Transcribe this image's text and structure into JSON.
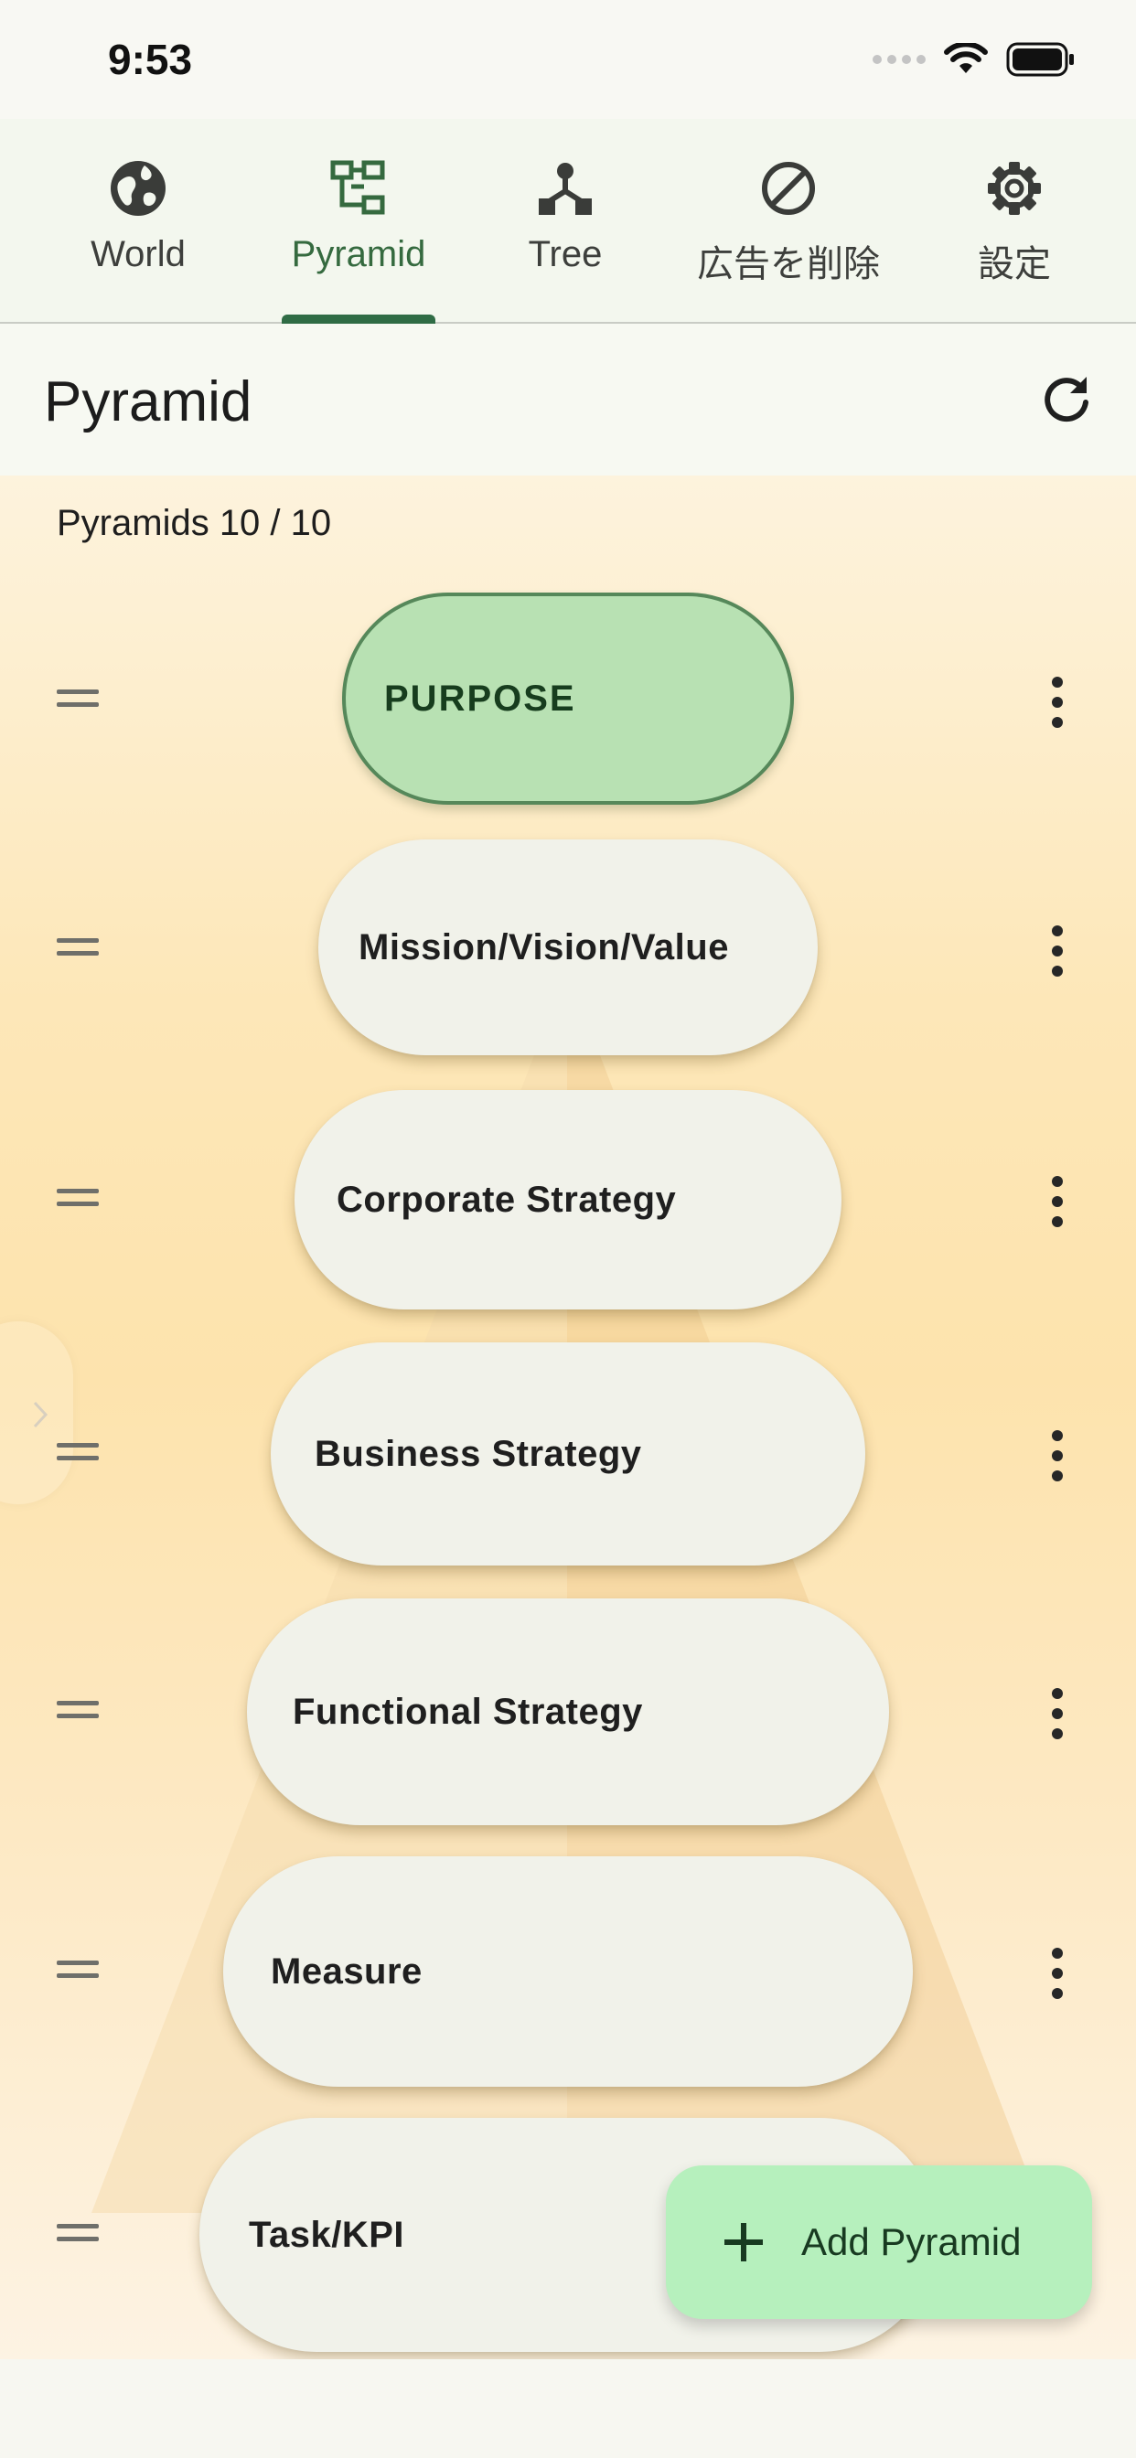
{
  "status_bar": {
    "time": "9:53"
  },
  "tabs": [
    {
      "label": "World",
      "icon": "globe-icon",
      "active": false
    },
    {
      "label": "Pyramid",
      "icon": "pyramid-blocks-icon",
      "active": true
    },
    {
      "label": "Tree",
      "icon": "tree-nodes-icon",
      "active": false
    },
    {
      "label": "広告を削除",
      "icon": "prohibited-icon",
      "active": false
    },
    {
      "label": "設定",
      "icon": "gear-icon",
      "active": false
    }
  ],
  "app_bar": {
    "title": "Pyramid",
    "refresh_icon": "refresh-icon"
  },
  "counter": "Pyramids 10 / 10",
  "levels": [
    {
      "label": "PURPOSE",
      "selected": true
    },
    {
      "label": "Mission/Vision/Value"
    },
    {
      "label": "Corporate Strategy"
    },
    {
      "label": "Business Strategy"
    },
    {
      "label": "Functional Strategy"
    },
    {
      "label": "Measure"
    },
    {
      "label": "Task/KPI"
    }
  ],
  "fab": {
    "label": "Add Pyramid",
    "icon": "plus-icon"
  },
  "colors": {
    "accent": "#356a3f",
    "purpose_fill": "#b8e1b3",
    "purpose_border": "#56885a",
    "fab_fill": "#b6f0bd",
    "background_warm": "#fde3ad"
  }
}
